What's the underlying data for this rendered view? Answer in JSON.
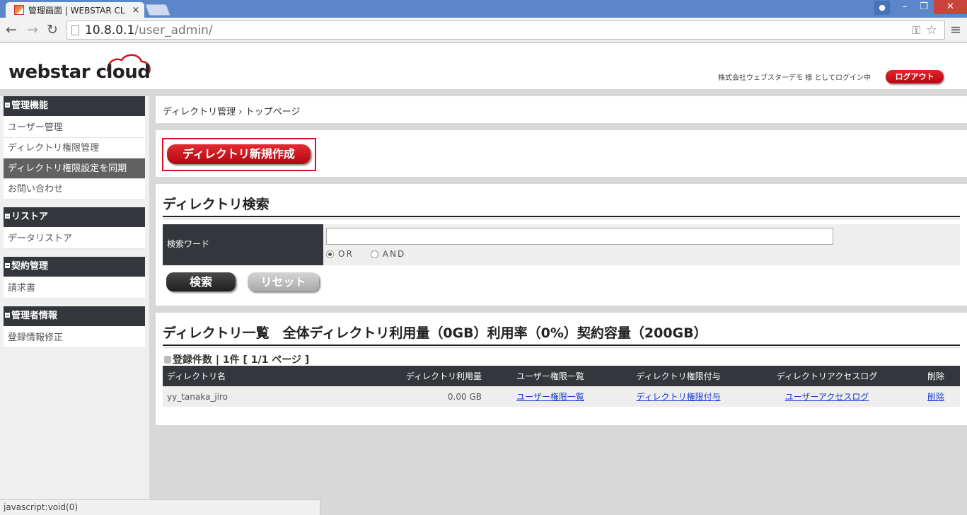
{
  "browser": {
    "tab_title": "管理画面 | WEBSTAR CL",
    "url_host": "10.8.0.1",
    "url_path": "/user_admin/",
    "status_text": "javascript:void(0)"
  },
  "header": {
    "logo_text": "webstar cloud",
    "login_info": "株式会社ウェブスターデモ 様 としてログイン中",
    "logout_label": "ログアウト"
  },
  "sidebar": {
    "sections": [
      {
        "heading": "管理機能",
        "items": [
          "ユーザー管理",
          "ディレクトリ権限管理",
          "ディレクトリ権限設定を同期",
          "お問い合わせ"
        ]
      },
      {
        "heading": "リストア",
        "items": [
          "データリストア"
        ]
      },
      {
        "heading": "契約管理",
        "items": [
          "請求書"
        ]
      },
      {
        "heading": "管理者情報",
        "items": [
          "登録情報修正"
        ]
      }
    ],
    "active_item": "ディレクトリ権限設定を同期"
  },
  "breadcrumb": {
    "parent": "ディレクトリ管理",
    "separator": "›",
    "current": "トップページ"
  },
  "new_directory_label": "ディレクトリ新規作成",
  "search": {
    "title": "ディレクトリ検索",
    "field_label": "検索ワード",
    "input_value": "",
    "options": [
      "OR",
      "AND"
    ],
    "selected_option": "OR",
    "search_label": "検索",
    "reset_label": "リセット"
  },
  "list": {
    "title": "ディレクトリ一覧　全体ディレクトリ利用量（0GB）利用率（0%）契約容量（200GB）",
    "count_text": "登録件数 | 1件 [ 1/1 ページ ]",
    "columns": [
      "ディレクトリ名",
      "ディレクトリ利用量",
      "ユーザー権限一覧",
      "ディレクトリ権限付与",
      "ディレクトリアクセスログ",
      "削除"
    ],
    "rows": [
      {
        "name": "yy_tanaka_jiro",
        "usage": "0.00 GB",
        "user_perm_link": "ユーザー権限一覧",
        "dir_perm_link": "ディレクトリ権限付与",
        "access_log_link": "ユーザーアクセスログ",
        "delete_link": "削除"
      }
    ]
  },
  "colors": {
    "accent_red": "#d4131c",
    "dark_header": "#33363b",
    "chrome_blue": "#5b86c9",
    "link_blue": "#1a3bd0"
  }
}
